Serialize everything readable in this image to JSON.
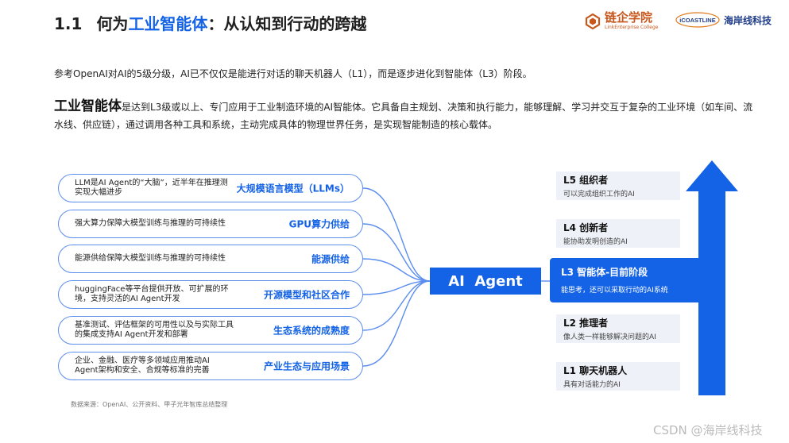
{
  "header": {
    "section_number": "1.1",
    "title_prefix": "何为",
    "title_highlight": "工业智能体",
    "title_suffix": "：从认知到行动的跨越"
  },
  "logos": {
    "linkenterprise_cn": "链企学院",
    "linkenterprise_en": "LinkEnterprise College",
    "icoastline_en": "iCOASTLINE",
    "icoastline_cn": "海岸线科技"
  },
  "intro_text": "参考OpenAI对AI的5级分级，AI已不仅仅是能进行对话的聊天机器人（L1），而是逐步进化到智能体（L3）阶段。",
  "definition": {
    "lead": "工业智能体",
    "body": "是达到L3级或以上、专门应用于工业制造环境的AI智能体。它具备自主规划、决策和执行能力，能够理解、学习并交互于复杂的工业环境（如车间、流水线、供应链），通过调用各种工具和系统，主动完成具体的物理世界任务，是实现智能制造的核心载体。"
  },
  "factors": [
    {
      "desc": "LLM是AI Agent的“大脑”，近半年在推理测实现大幅进步",
      "label": "大规模语言模型（LLMs）"
    },
    {
      "desc": "强大算力保障大模型训练与推理的可持续性",
      "label": "GPU算力供给"
    },
    {
      "desc": "能源供给保障大模型训练与推理的可持续性",
      "label": "能源供给"
    },
    {
      "desc": "huggingFace等平台提供开放、可扩展的环境，支持灵活的AI Agent开发",
      "label": "开源模型和社区合作"
    },
    {
      "desc": "基准测试、评估框架的可用性以及与实际工具的集成支持AI Agent开发和部署",
      "label": "生态系统的成熟度"
    },
    {
      "desc": "企业、金融、医疗等多领域应用推动AI Agent架构和安全、合规等标准的完善",
      "label": "产业生态与应用场景"
    }
  ],
  "center_label": "AI  Agent",
  "levels": [
    {
      "name": "L5 组织者",
      "desc": "可以完成组织工作的AI"
    },
    {
      "name": "L4 创新者",
      "desc": "能协助发明创造的AI"
    },
    {
      "name": "L3 智能体-目前阶段",
      "desc": "能思考，还可以采取行动的AI系统"
    },
    {
      "name": "L2 推理者",
      "desc": "像人类一样能够解决问题的AI"
    },
    {
      "name": "L1 聊天机器人",
      "desc": "具有对话能力的AI"
    }
  ],
  "source_note": "数据来源：OpenAI、公开资料、甲子光年智库总结整理",
  "watermark": "CSDN @海岸线科技",
  "colors": {
    "accent": "#1463e6",
    "level_bg": "#eef1f7",
    "brand_orange": "#c8571c",
    "brand_navy": "#1f3c88"
  }
}
